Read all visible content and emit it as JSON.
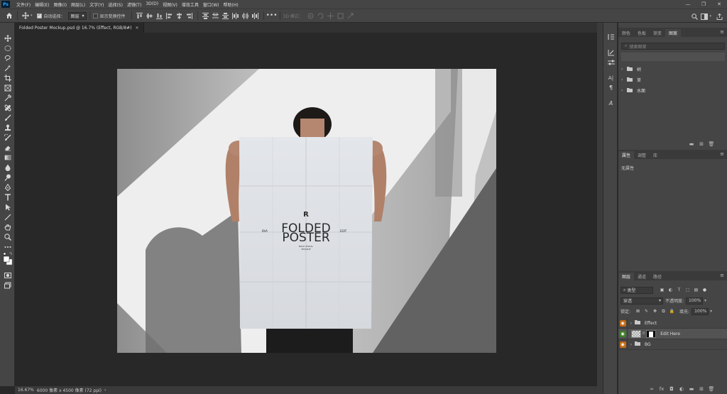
{
  "app": {
    "logo": "Ps"
  },
  "menu": [
    "文件(F)",
    "编辑(E)",
    "图像(I)",
    "图层(L)",
    "文字(Y)",
    "选择(S)",
    "滤镜(T)",
    "3D(D)",
    "视图(V)",
    "增效工具",
    "窗口(W)",
    "帮助(H)"
  ],
  "window_controls": {
    "minimize": "—",
    "restore": "❐",
    "close": "✕"
  },
  "options": {
    "auto_select_label": "自动选择：",
    "auto_select_value": "图层",
    "show_transform_label": "显示变换控件",
    "mode_3d_label": "3D 模式："
  },
  "document": {
    "tab_title": "Folded Poster Mockup.psd @ 16.7% (Effect, RGB/8#)",
    "close": "✕"
  },
  "poster": {
    "logo": "R",
    "title_line1": "FOLDED",
    "title_line2": "POSTER",
    "subtitle_line1": "BOLD VISUAL",
    "subtitle_line2": "MOCKUP",
    "left_tag": "BVA",
    "right_tag": "EDIT"
  },
  "status": {
    "zoom": "16.67%",
    "doc_info": "6000 像素 x 4500 像素 (72 ppi)",
    "arrow": "›"
  },
  "swatches_panel": {
    "tabs": [
      "颜色",
      "色板",
      "渐变",
      "图案"
    ],
    "active_tab": 3,
    "search_placeholder": "搜索图案",
    "folders": [
      "树",
      "草",
      "水面"
    ]
  },
  "properties_panel": {
    "tabs": [
      "属性",
      "调整",
      "库"
    ],
    "active_tab": 0,
    "empty_text": "无属性"
  },
  "layers_panel": {
    "tabs": [
      "图层",
      "通道",
      "路径"
    ],
    "active_tab": 0,
    "filter_kind": "类型",
    "blend_mode": "穿透",
    "opacity_label": "不透明度:",
    "opacity_value": "100%",
    "lock_label": "锁定:",
    "fill_label": "填充:",
    "fill_value": "100%",
    "layers": [
      {
        "name": "Effect",
        "type": "group",
        "eye_color": "#c36a16",
        "selected": false
      },
      {
        "name": "Edit Here",
        "type": "smart",
        "eye_color": "#3f7f2a",
        "selected": true
      },
      {
        "name": "BG",
        "type": "group",
        "eye_color": "#c36a16",
        "selected": false
      }
    ]
  }
}
